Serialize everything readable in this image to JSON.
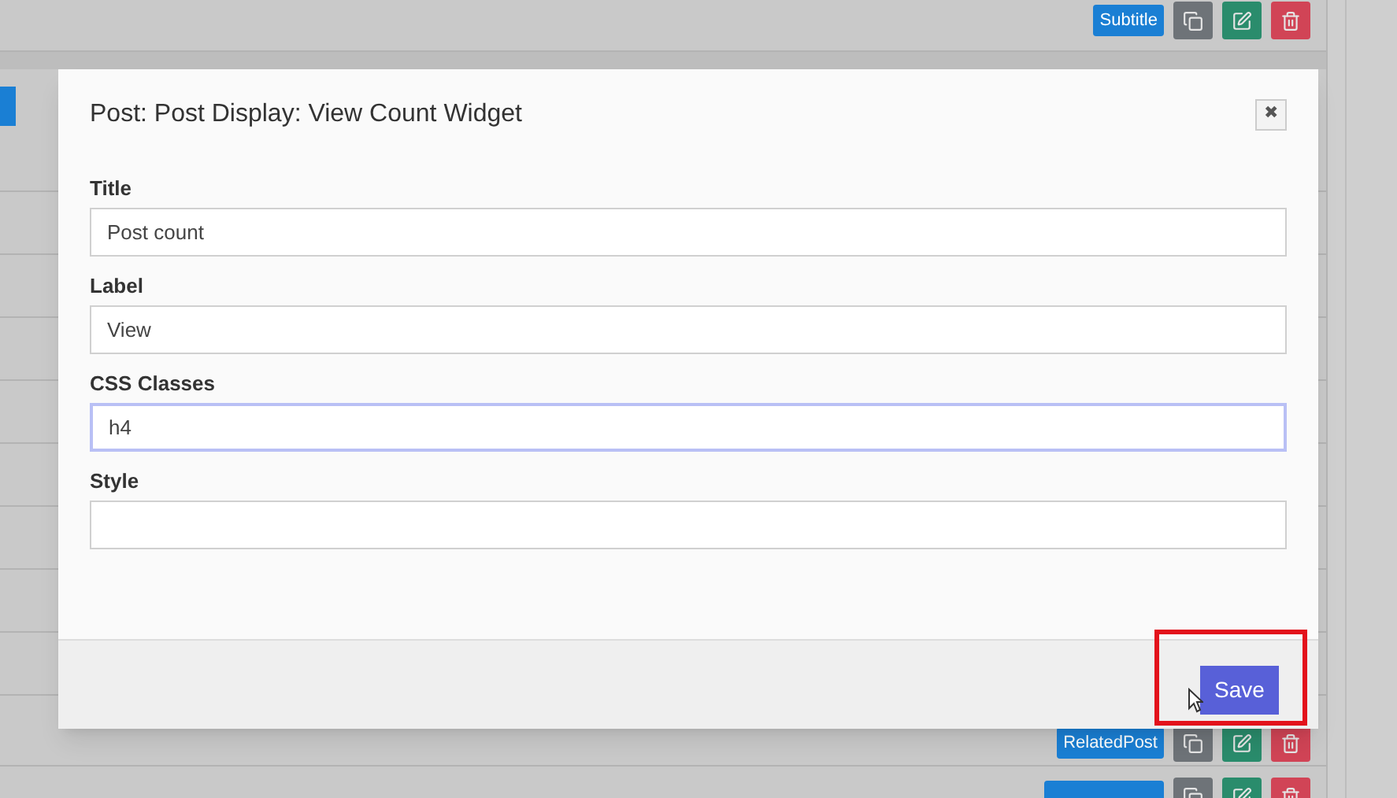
{
  "top_row": {
    "badge": "Subtitle"
  },
  "lower_row": {
    "badge": "RelatedPost"
  },
  "bottom_row": {
    "kind": "cut"
  },
  "modal": {
    "title": "Post: Post Display: View Count Widget",
    "close": "✖",
    "fields": [
      {
        "label": "Title",
        "value": "Post count",
        "focused": false
      },
      {
        "label": "Label",
        "value": "View",
        "focused": false
      },
      {
        "label": "CSS Classes",
        "value": "h4",
        "focused": true
      },
      {
        "label": "Style",
        "focused": false
      }
    ],
    "save_button": "Save"
  }
}
